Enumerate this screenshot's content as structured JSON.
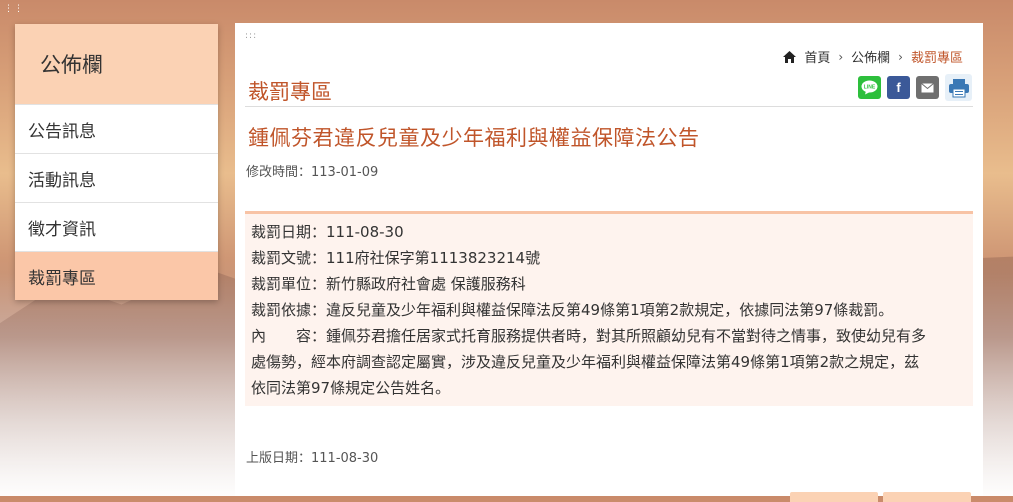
{
  "sidebar": {
    "title": "公佈欄",
    "items": [
      {
        "label": "公告訊息"
      },
      {
        "label": "活動訊息"
      },
      {
        "label": "徵才資訊"
      },
      {
        "label": "裁罰專區"
      }
    ]
  },
  "breadcrumb": {
    "home": "首頁",
    "level1": "公佈欄",
    "current": "裁罰專區"
  },
  "section_title": "裁罰專區",
  "article": {
    "title": "鍾佩芬君違反兒童及少年福利與權益保障法公告",
    "modified_label": "修改時間：",
    "modified_value": "113-01-09",
    "rows": {
      "date_label": "裁罰日期：",
      "date_value": "111-08-30",
      "doc_label": "裁罰文號：",
      "doc_value": "111府社保字第1113823214號",
      "unit_label": "裁罰單位：",
      "unit_value": "新竹縣政府社會處 保護服務科",
      "basis_label": "裁罰依據：",
      "basis_value": "違反兒童及少年福利與權益保障法反第49條第1項第2款規定，依據同法第97條裁罰。",
      "content_label": "內　　容：",
      "content_line1": "鍾佩芬君擔任居家式托育服務提供者時，對其所照顧幼兒有不當對待之情事，致使幼兒有多",
      "content_line2": "處傷勢，經本府調查認定屬實，涉及違反兒童及少年福利與權益保障法第49條第1項第2款之規定，茲",
      "content_line3": "依同法第97條規定公告姓名。"
    },
    "published_label": "上版日期：",
    "published_value": "111-08-30"
  },
  "share": {
    "line": "LINE",
    "facebook": "f",
    "mail": "✉",
    "print": "print"
  },
  "colors": {
    "accent": "#c0552a",
    "sidebar_head": "#fbd2b4",
    "active_item": "#fbc7a8",
    "content_bg": "#fef3ee"
  }
}
